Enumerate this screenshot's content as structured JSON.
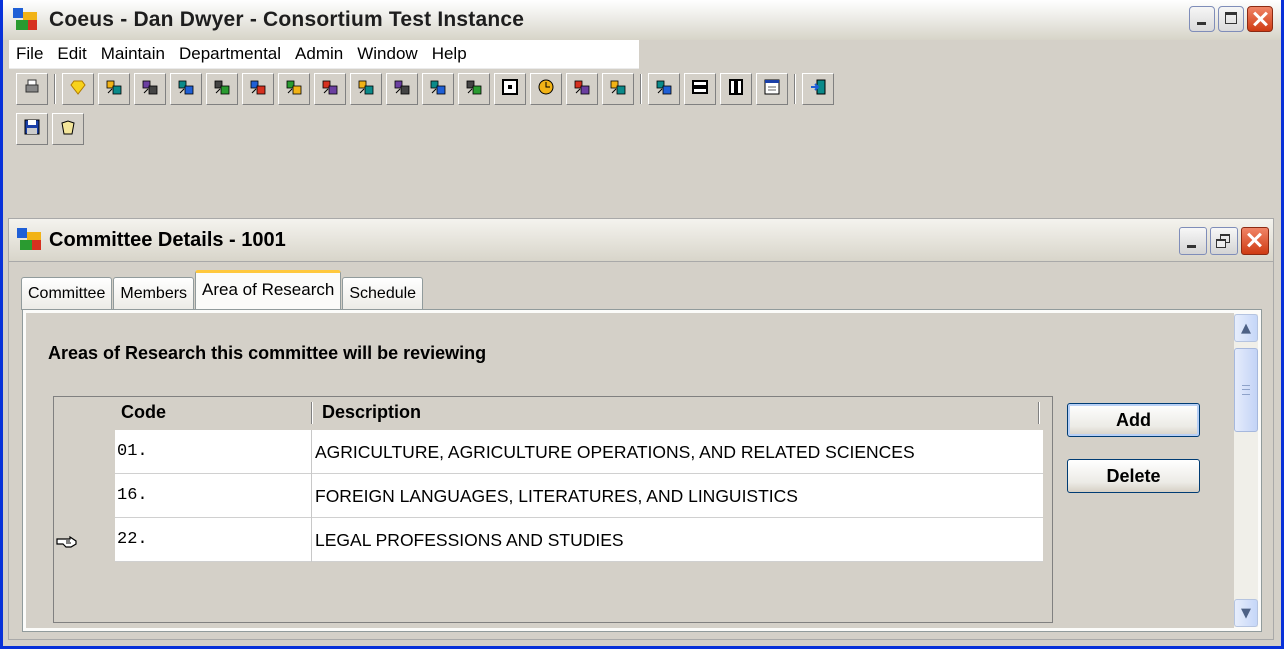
{
  "window": {
    "title": "Coeus  -  Dan Dwyer  -  Consortium Test Instance"
  },
  "menu": [
    "File",
    "Edit",
    "Maintain",
    "Departmental",
    "Admin",
    "Window",
    "Help"
  ],
  "toolbar": {
    "row1": [
      {
        "icon": "print-icon"
      },
      {
        "sep": true
      },
      {
        "icon": "gem-icon"
      },
      {
        "icon": "copy-document-icon"
      },
      {
        "icon": "proposal-routing-icon"
      },
      {
        "icon": "stacked-windows-icon"
      },
      {
        "icon": "money-bag-icon"
      },
      {
        "icon": "grid-table-icon"
      },
      {
        "icon": "org-chart-icon"
      },
      {
        "icon": "formula-icon"
      },
      {
        "icon": "shuffle-icon"
      },
      {
        "icon": "people-group-icon"
      },
      {
        "icon": "persons-pair-icon"
      },
      {
        "icon": "hierarchy-icon"
      },
      {
        "icon": "calendar-square-icon"
      },
      {
        "icon": "clock-icon"
      },
      {
        "icon": "team-icon"
      },
      {
        "icon": "computer-user-icon"
      },
      {
        "sep": true
      },
      {
        "icon": "tree-nodes-icon"
      },
      {
        "icon": "tile-horizontal-icon"
      },
      {
        "icon": "tile-vertical-icon"
      },
      {
        "icon": "cascade-icon"
      },
      {
        "sep": true
      },
      {
        "icon": "exit-door-icon"
      }
    ],
    "row2": [
      {
        "icon": "save-disk-icon"
      },
      {
        "icon": "open-folder-icon"
      }
    ]
  },
  "inner_window": {
    "title": "Committee Details - 1001"
  },
  "tabs": [
    "Committee",
    "Members",
    "Area of Research",
    "Schedule"
  ],
  "active_tab": "Area of Research",
  "section_label": "Areas of Research this committee will be reviewing",
  "table": {
    "columns": [
      "Code",
      "Description"
    ],
    "rows": [
      {
        "code": "01.",
        "description": "AGRICULTURE, AGRICULTURE OPERATIONS, AND RELATED SCIENCES"
      },
      {
        "code": "16.",
        "description": "FOREIGN LANGUAGES, LITERATURES, AND LINGUISTICS"
      },
      {
        "code": "22.",
        "description": "LEGAL PROFESSIONS AND STUDIES"
      }
    ],
    "selected_row_index": 2
  },
  "buttons": {
    "add": "Add",
    "delete": "Delete"
  },
  "colors": {
    "window_face": "#d4d0c8",
    "tab_highlight": "#ffc83c",
    "close_button": "#cf3b13"
  }
}
